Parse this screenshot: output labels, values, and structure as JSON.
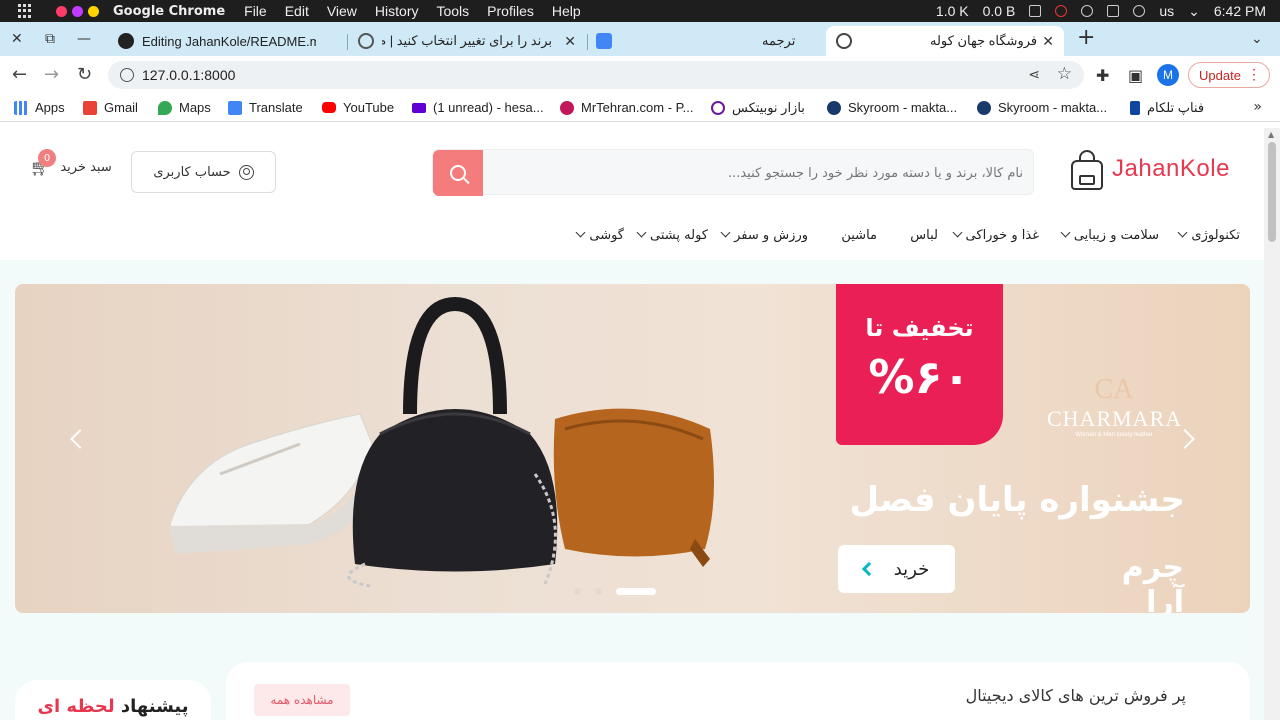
{
  "os": {
    "app_name": "Google Chrome",
    "menu": [
      "File",
      "Edit",
      "View",
      "History",
      "Tools",
      "Profiles",
      "Help"
    ],
    "net_down": "1.0 K",
    "net_up": "0.0 B",
    "keyboard": "us",
    "time": "6:42 PM",
    "dot_colors": [
      "#ff3b6b",
      "#c23bff",
      "#ffd400"
    ]
  },
  "tabs": [
    {
      "title": "Editing JahanKole/README.m",
      "icon": "github-icon",
      "active": false
    },
    {
      "title": "برند را برای تغییر انتخاب کنید | م",
      "icon": "globe-icon",
      "active": false
    },
    {
      "title": "ترجمه",
      "icon": "translate-icon",
      "active": false
    },
    {
      "title": "فروشگاه جهان کوله",
      "icon": "globe-icon",
      "active": true
    }
  ],
  "address": {
    "url": "127.0.0.1:8000",
    "avatar_letter": "M",
    "update_label": "Update"
  },
  "bookmarks": [
    {
      "label": "Apps",
      "icon": "apps-grid-icon",
      "color": "#4285f4"
    },
    {
      "label": "Gmail",
      "icon": "gmail-icon",
      "color": "#ea4335"
    },
    {
      "label": "Maps",
      "icon": "maps-icon",
      "color": "#34a853"
    },
    {
      "label": "Translate",
      "icon": "translate-icon",
      "color": "#4285f4"
    },
    {
      "label": "YouTube",
      "icon": "youtube-icon",
      "color": "#ff0000"
    },
    {
      "label": "(1 unread) - hesa...",
      "icon": "mail-icon",
      "color": "#6001d2"
    },
    {
      "label": "MrTehran.com - P...",
      "icon": "mrtehran-icon",
      "color": "#c2185b"
    },
    {
      "label": "بازار نوبیتکس",
      "icon": "nobitex-icon",
      "color": "#6a1b9a"
    },
    {
      "label": "Skyroom - makta...",
      "icon": "skyroom-icon",
      "color": "#1a3a6b"
    },
    {
      "label": "Skyroom - makta...",
      "icon": "skyroom-icon",
      "color": "#1a3a6b"
    },
    {
      "label": "فناپ تلکام",
      "icon": "fanap-icon",
      "color": "#0d47a1"
    }
  ],
  "site": {
    "logo_text": "JahanKole",
    "search_placeholder": "نام کالا، برند و یا دسته مورد نظر خود را جستجو کنید...",
    "account_label": "حساب کاربری",
    "cart_label": "سبد خرید",
    "cart_count": "0",
    "categories": [
      {
        "label": "تکنولوژی",
        "dropdown": true
      },
      {
        "label": "سلامت و زیبایی",
        "dropdown": true
      },
      {
        "label": "غذا و خوراکی",
        "dropdown": true
      },
      {
        "label": "لباس",
        "dropdown": false
      },
      {
        "label": "ماشین",
        "dropdown": false
      },
      {
        "label": "ورزش و سفر",
        "dropdown": true
      },
      {
        "label": "کوله پشتی",
        "dropdown": true
      },
      {
        "label": "گوشی",
        "dropdown": true
      }
    ],
    "accent_color": "#e53950"
  },
  "banner": {
    "promo_line1": "تخفیف تا",
    "promo_line2": "%۶۰",
    "brand_mono": "CA",
    "brand_name": "CHARMARA",
    "brand_sub": "Woman & Men luxury leather",
    "festival": "جشنواره پایان فصل",
    "brand_fa": "چرم آرا",
    "buy_label": "خرید",
    "slides": 3,
    "active_slide": 3
  },
  "sections": {
    "bestsell_title": "پر فروش ترین های کالای دیجیتال",
    "view_all": "مشاهده همه",
    "flash_title_a": "پیشنهاد",
    "flash_title_b": "لحظه ای"
  }
}
